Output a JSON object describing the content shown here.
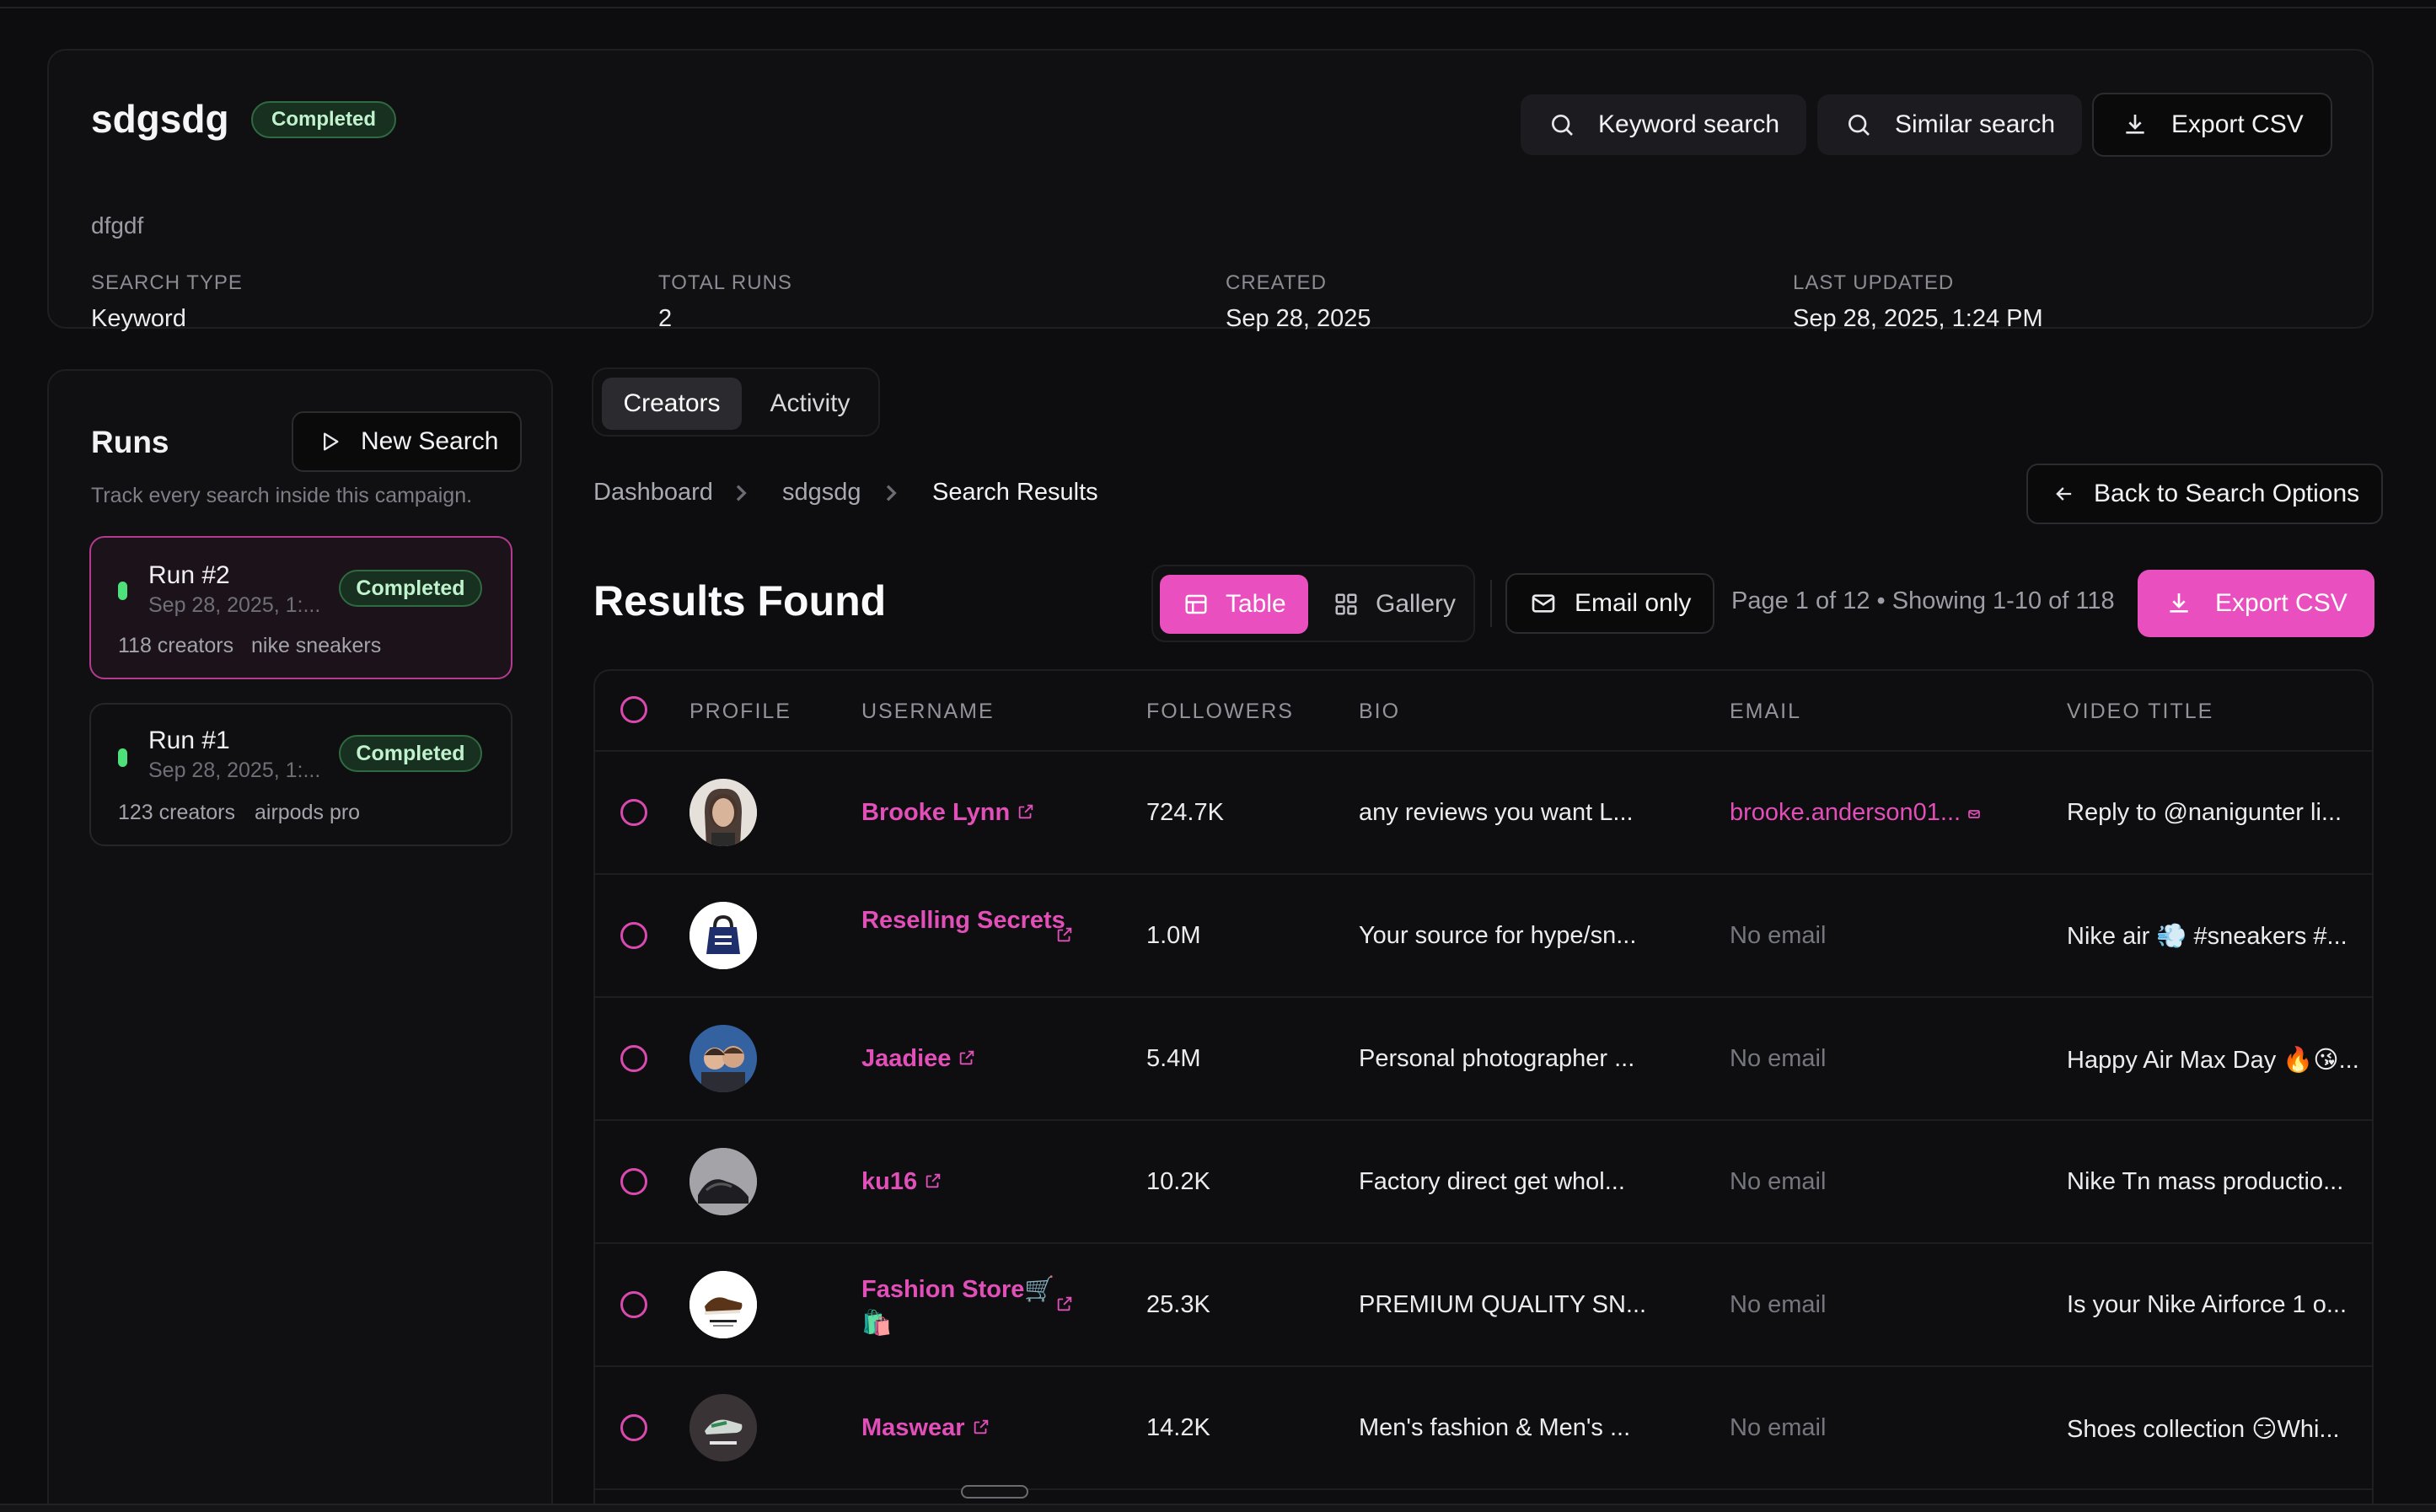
{
  "header": {
    "title": "sdgsdg",
    "status": "Completed",
    "subtitle": "dfgdf",
    "keyword_search_label": "Keyword search",
    "similar_search_label": "Similar search",
    "export_label": "Export CSV",
    "meta": [
      {
        "label": "SEARCH TYPE",
        "value": "Keyword"
      },
      {
        "label": "TOTAL RUNS",
        "value": "2"
      },
      {
        "label": "CREATED",
        "value": "Sep 28, 2025"
      },
      {
        "label": "LAST UPDATED",
        "value": "Sep 28, 2025, 1:24 PM"
      }
    ]
  },
  "runs": {
    "title": "Runs",
    "new_search_label": "New Search",
    "description": "Track every search inside this campaign.",
    "items": [
      {
        "name": "Run #2",
        "date": "Sep 28, 2025, 1:...",
        "status": "Completed",
        "creators": "118 creators",
        "query": "nike sneakers",
        "active": true
      },
      {
        "name": "Run #1",
        "date": "Sep 28, 2025, 1:...",
        "status": "Completed",
        "creators": "123 creators",
        "query": "airpods pro",
        "active": false
      }
    ]
  },
  "tabs": [
    {
      "label": "Creators",
      "active": true
    },
    {
      "label": "Activity",
      "active": false
    }
  ],
  "breadcrumb": [
    "Dashboard",
    "sdgsdg",
    "Search Results"
  ],
  "back_label": "Back to Search Options",
  "results": {
    "title": "Results Found",
    "table_label": "Table",
    "gallery_label": "Gallery",
    "email_only_label": "Email only",
    "page_info": "Page 1 of 12 • Showing 1-10 of 118",
    "export_label": "Export CSV"
  },
  "table": {
    "columns": [
      "PROFILE",
      "USERNAME",
      "FOLLOWERS",
      "BIO",
      "EMAIL",
      "VIDEO TITLE"
    ],
    "rows": [
      {
        "username": "Brooke Lynn",
        "followers": "724.7K",
        "bio": "any reviews you want L...",
        "email": "brooke.anderson01...",
        "has_email": true,
        "video": "Reply to @nanigunter li..."
      },
      {
        "username": "Reselling Secrets",
        "followers": "1.0M",
        "bio": "Your source for hype/sn...",
        "email": "No email",
        "has_email": false,
        "video": "Nike air 💨 #sneakers #..."
      },
      {
        "username": "Jaadiee",
        "followers": "5.4M",
        "bio": "Personal photographer ...",
        "email": "No email",
        "has_email": false,
        "video": "Happy Air Max Day 🔥😘..."
      },
      {
        "username": "ku16",
        "followers": "10.2K",
        "bio": "Factory direct get whol...",
        "email": "No email",
        "has_email": false,
        "video": "Nike Tn mass productio..."
      },
      {
        "username": "Fashion Store🛒 🛍️",
        "followers": "25.3K",
        "bio": "PREMIUM QUALITY SN...",
        "email": "No email",
        "has_email": false,
        "video": "Is your Nike Airforce 1 o..."
      },
      {
        "username": "Maswear",
        "followers": "14.2K",
        "bio": "Men's fashion & Men's ...",
        "email": "No email",
        "has_email": false,
        "video": "Shoes collection 😏Whi..."
      }
    ]
  },
  "colors": {
    "accent": "#e94fbe",
    "status_green": "#4ee07a",
    "background": "#0d0d0f"
  },
  "icons": [
    "search-icon",
    "download-icon",
    "play-icon",
    "arrow-left-icon",
    "table-icon",
    "grid-icon",
    "mail-icon",
    "chevron-right-icon",
    "external-link-icon"
  ]
}
